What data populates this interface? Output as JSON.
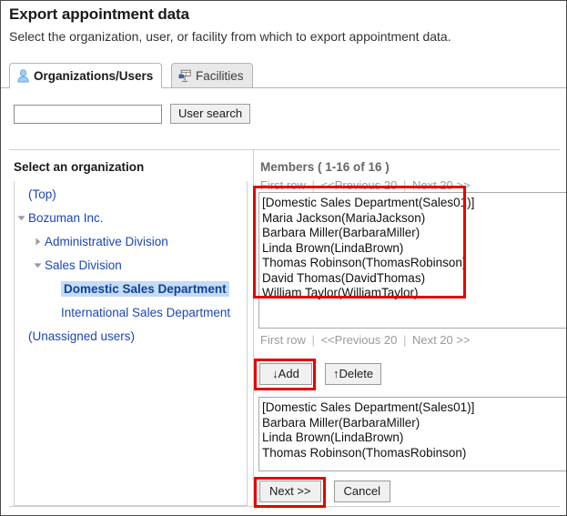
{
  "page": {
    "title": "Export appointment data",
    "description": "Select the organization, user, or facility from which to export appointment data."
  },
  "tabs": [
    {
      "label": "Organizations/Users",
      "icon": "user-icon",
      "active": true
    },
    {
      "label": "Facilities",
      "icon": "projector-icon",
      "active": false
    }
  ],
  "search": {
    "value": "",
    "placeholder": "",
    "button_label": "User search"
  },
  "left_pane": {
    "heading": "Select an organization",
    "tree": [
      {
        "label": "(Top)",
        "indent": 0,
        "arrow": "none",
        "selected": false
      },
      {
        "label": "Bozuman Inc.",
        "indent": 0,
        "arrow": "expanded",
        "selected": false
      },
      {
        "label": "Administrative Division",
        "indent": 1,
        "arrow": "collapsed",
        "selected": false
      },
      {
        "label": "Sales Division",
        "indent": 1,
        "arrow": "expanded",
        "selected": false
      },
      {
        "label": "Domestic Sales Department",
        "indent": 2,
        "arrow": "none",
        "selected": true
      },
      {
        "label": "International Sales Department",
        "indent": 2,
        "arrow": "none",
        "selected": false
      },
      {
        "label": "(Unassigned users)",
        "indent": 0,
        "arrow": "none",
        "selected": false
      }
    ]
  },
  "right_pane": {
    "members_heading": "Members ( 1-16 of 16 )",
    "pager": {
      "first_row": "First row",
      "previous": "<<Previous 20",
      "next": "Next 20 >>",
      "separator": "|"
    },
    "members_list": [
      "[Domestic Sales Department(Sales01)]",
      "Maria Jackson(MariaJackson)",
      "Barbara Miller(BarbaraMiller)",
      "Linda Brown(LindaBrown)",
      "Thomas Robinson(ThomasRobinson)",
      "David Thomas(DavidThomas)",
      "William Taylor(WilliamTaylor)"
    ],
    "add_label": "↓Add",
    "delete_label": "↑Delete",
    "selected_list": [
      "[Domestic Sales Department(Sales01)]",
      "Barbara Miller(BarbaraMiller)",
      "Linda Brown(LindaBrown)",
      "Thomas Robinson(ThomasRobinson)"
    ],
    "next_label": "Next >>",
    "cancel_label": "Cancel"
  },
  "colors": {
    "link": "#1c46b4",
    "selected_bg": "#c4dcf4",
    "annotation": "#e60000",
    "muted": "#9a9a9a"
  }
}
